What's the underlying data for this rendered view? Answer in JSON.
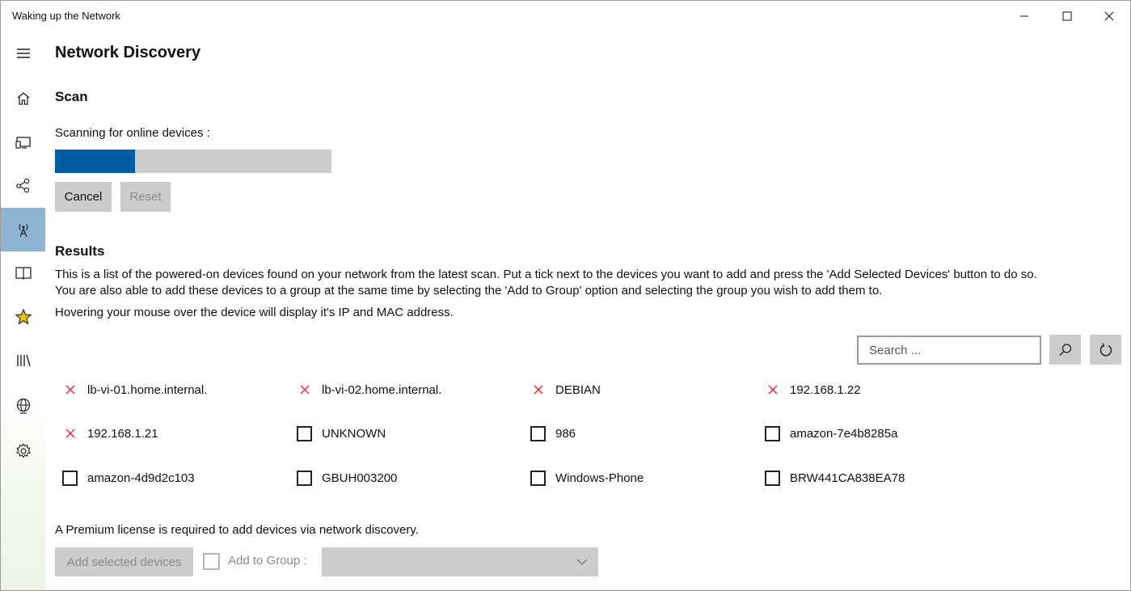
{
  "window": {
    "title": "Waking up the Network",
    "controls": [
      "minimize-icon",
      "maximize-icon",
      "close-icon"
    ]
  },
  "sidebar": {
    "items": [
      {
        "name": "menu",
        "icon": "hamburger-icon"
      },
      {
        "name": "home",
        "icon": "home-icon"
      },
      {
        "name": "devices",
        "icon": "devices-icon"
      },
      {
        "name": "groups",
        "icon": "network-nodes-icon"
      },
      {
        "name": "network-discovery",
        "icon": "antenna-icon",
        "active": true
      },
      {
        "name": "book",
        "icon": "book-icon"
      },
      {
        "name": "favorites",
        "icon": "star-icon"
      },
      {
        "name": "library",
        "icon": "library-icon"
      },
      {
        "name": "globe",
        "icon": "globe-icon"
      },
      {
        "name": "settings",
        "icon": "gear-icon"
      }
    ]
  },
  "page": {
    "title": "Network Discovery"
  },
  "scan": {
    "heading": "Scan",
    "status_label": "Scanning for online devices :",
    "progress": 0.29,
    "cancel_label": "Cancel",
    "reset_label": "Reset"
  },
  "results": {
    "heading": "Results",
    "description_line1": "This is a list of the powered-on devices found on your network from the latest scan. Put a tick next to the devices you want to add and press the 'Add Selected Devices' button to do so.",
    "description_line2": "You are also able to add these devices to a group at the same time by selecting the 'Add to Group' option and selecting the group you wish to add them to.",
    "hover_hint": "Hovering your mouse over the device will display it's IP and MAC address.",
    "search_placeholder": "Search ...",
    "devices": [
      {
        "name": "lb-vi-01.home.internal.",
        "state": "unavailable"
      },
      {
        "name": "lb-vi-02.home.internal.",
        "state": "unavailable"
      },
      {
        "name": "DEBIAN",
        "state": "unavailable"
      },
      {
        "name": "192.168.1.22",
        "state": "unavailable"
      },
      {
        "name": "192.168.1.21",
        "state": "unavailable"
      },
      {
        "name": "UNKNOWN",
        "state": "unchecked"
      },
      {
        "name": "986",
        "state": "unchecked"
      },
      {
        "name": "amazon-7e4b8285a",
        "state": "unchecked"
      },
      {
        "name": "amazon-4d9d2c103",
        "state": "unchecked"
      },
      {
        "name": "GBUH003200",
        "state": "unchecked"
      },
      {
        "name": "Windows-Phone",
        "state": "unchecked"
      },
      {
        "name": "BRW441CA838EA78",
        "state": "unchecked"
      }
    ]
  },
  "footer": {
    "license_notice": "A Premium license is required to add devices via network discovery.",
    "add_selected_label": "Add selected devices",
    "add_to_group_label": "Add to Group :"
  },
  "colors": {
    "accent": "#005ca3",
    "sidebar_active": "#8fb3d3",
    "button_bg": "#cccccc",
    "unavailable_mark": "#e8262e"
  }
}
